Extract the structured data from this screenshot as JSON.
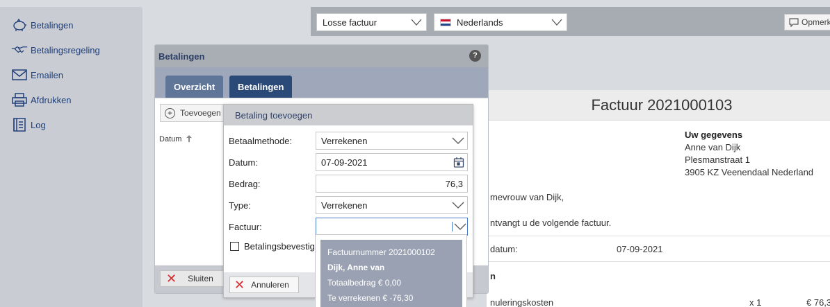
{
  "sidebar": {
    "items": [
      {
        "label": "Betalingen",
        "icon": "piggy-bank-icon"
      },
      {
        "label": "Betalingsregeling",
        "icon": "handshake-icon"
      },
      {
        "label": "Emailen",
        "icon": "envelope-icon"
      },
      {
        "label": "Afdrukken",
        "icon": "printer-icon"
      },
      {
        "label": "Log",
        "icon": "log-book-icon"
      }
    ]
  },
  "topbar": {
    "invoice_type": "Losse factuur",
    "language": "Nederlands",
    "opmerk_label": "Opmerk"
  },
  "invoice": {
    "title": "Factuur 2021000103",
    "your_details_heading": "Uw gegevens",
    "name": "Anne van Dijk",
    "street": "Plesmanstraat 1",
    "city": "3905 KZ Veenendaal Nederland",
    "salutation": "mevrouw van Dijk,",
    "intro": "ntvangt u de volgende factuur.",
    "date_label": "datum:",
    "date_value": "07-09-2021",
    "section_label": "n",
    "line_label": "nuleringskosten",
    "line_qty": "x 1",
    "line_amount": "€ 76,3"
  },
  "panel": {
    "title": "Betalingen",
    "help": "?",
    "tabs": [
      {
        "label": "Overzicht"
      },
      {
        "label": "Betalingen"
      }
    ],
    "add_button": "Toevoegen",
    "add_icon": "+",
    "column_datum": "Datum",
    "close_button": "Sluiten"
  },
  "dialog": {
    "title": "Betaling toevoegen",
    "fields": {
      "betaalmethode": {
        "label": "Betaalmethode:",
        "value": "Verrekenen"
      },
      "datum": {
        "label": "Datum:",
        "value": "07-09-2021"
      },
      "bedrag": {
        "label": "Bedrag:",
        "value": "76,3"
      },
      "type": {
        "label": "Type:",
        "value": "Verrekenen"
      },
      "factuur": {
        "label": "Factuur:",
        "value": ""
      }
    },
    "checkbox_label": "Betalingsbevestigi",
    "cancel_button": "Annuleren",
    "close_glyph": "✕"
  },
  "dropdown": {
    "factuurnummer": "Factuurnummer 2021000102",
    "customer": "Dijk, Anne van",
    "total": "Totaalbedrag € 0,00",
    "to_settle": "Te verrekenen € -76,30"
  },
  "colors": {
    "accent_dark": "#2c4a78",
    "tab_inactive": "#5f7699",
    "close_red": "#d9262b",
    "link_blue": "#1f3f7a"
  }
}
